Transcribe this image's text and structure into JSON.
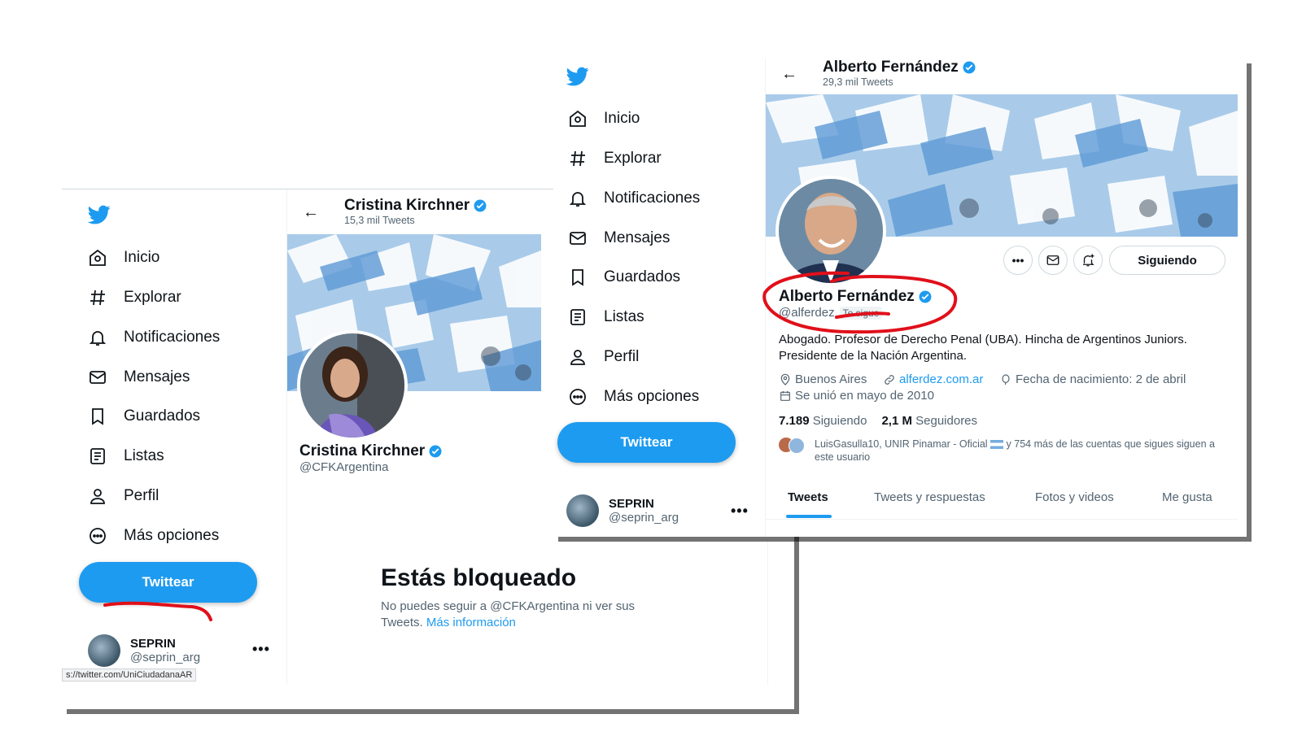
{
  "left": {
    "nav": [
      {
        "label": "Inicio",
        "icon": "home-icon"
      },
      {
        "label": "Explorar",
        "icon": "hashtag-icon"
      },
      {
        "label": "Notificaciones",
        "icon": "bell-icon"
      },
      {
        "label": "Mensajes",
        "icon": "envelope-icon"
      },
      {
        "label": "Guardados",
        "icon": "bookmark-icon"
      },
      {
        "label": "Listas",
        "icon": "list-icon"
      },
      {
        "label": "Perfil",
        "icon": "person-icon"
      },
      {
        "label": "Más opciones",
        "icon": "more-circle-icon"
      }
    ],
    "tweet_button": "Twittear",
    "account": {
      "name": "SEPRIN",
      "handle": "@seprin_arg"
    },
    "profile": {
      "header_name": "Cristina Kirchner",
      "header_tweets": "15,3 mil Tweets",
      "name": "Cristina Kirchner",
      "handle": "@CFKArgentina"
    },
    "blocked": {
      "title": "Estás bloqueado",
      "text": "No puedes seguir a @CFKArgentina ni ver sus",
      "text2": "Tweets.",
      "link": "Más información"
    },
    "status_url": "s://twitter.com/UniCiudadanaAR"
  },
  "right": {
    "nav": [
      {
        "label": "Inicio",
        "icon": "home-icon"
      },
      {
        "label": "Explorar",
        "icon": "hashtag-icon"
      },
      {
        "label": "Notificaciones",
        "icon": "bell-icon"
      },
      {
        "label": "Mensajes",
        "icon": "envelope-icon"
      },
      {
        "label": "Guardados",
        "icon": "bookmark-icon"
      },
      {
        "label": "Listas",
        "icon": "list-icon"
      },
      {
        "label": "Perfil",
        "icon": "person-icon"
      },
      {
        "label": "Más opciones",
        "icon": "more-circle-icon"
      }
    ],
    "tweet_button": "Twittear",
    "account": {
      "name": "SEPRIN",
      "handle": "@seprin_arg"
    },
    "profile": {
      "header_name": "Alberto Fernández",
      "header_tweets": "29,3 mil Tweets",
      "name": "Alberto Fernández",
      "handle": "@alferdez",
      "follows_you": "Te sigue",
      "follow_button": "Siguiendo",
      "bio_line1": "Abogado. Profesor de Derecho Penal (UBA). Hincha de Argentinos Juniors.",
      "bio_line2": "Presidente de la Nación Argentina.",
      "location": "Buenos Aires",
      "website": "alferdez.com.ar",
      "birthday": "Fecha de nacimiento: 2 de abril",
      "joined": "Se unió en mayo de 2010",
      "following_count": "7.189",
      "following_label": "Siguiendo",
      "followers_count": "2,1 M",
      "followers_label": "Seguidores",
      "followed_by": "LuisGasulla10, UNIR Pinamar - Oficial",
      "followed_by_rest": "y 754 más de las cuentas que sigues siguen a",
      "followed_by_rest2": "este usuario"
    },
    "tabs": [
      "Tweets",
      "Tweets y respuestas",
      "Fotos y videos",
      "Me gusta"
    ]
  },
  "colors": {
    "brand": "#1d9bf0",
    "annotation": "#e0101a",
    "text": "#0f1419",
    "muted": "#536471"
  }
}
